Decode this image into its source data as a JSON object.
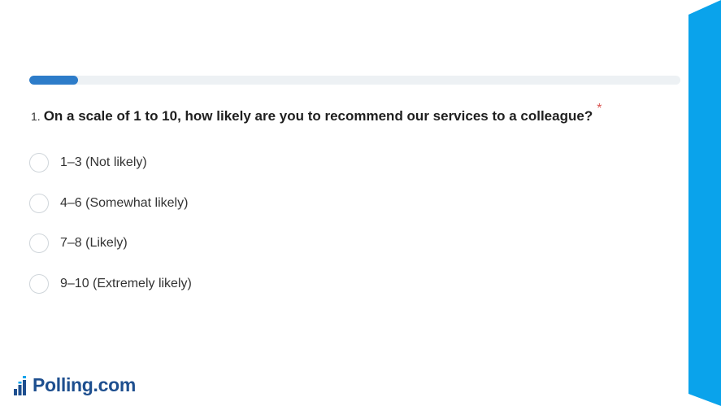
{
  "survey": {
    "progress": 0.075,
    "question": {
      "number": "1.",
      "text": "On a scale of 1 to 10, how likely are you to recommend our services to a colleague?",
      "required_marker": "*"
    },
    "options": [
      "1–3 (Not likely)",
      "4–6 (Somewhat likely)",
      "7–8 (Likely)",
      "9–10 (Extremely likely)"
    ]
  },
  "brand": {
    "name": "Polling.com",
    "icon": "bar-chart-stairs-icon"
  },
  "colors": {
    "progress_fill": "#2d7cc9",
    "progress_track": "#edf1f4",
    "side_accent": "#0aa3eb",
    "required": "#d9534f",
    "brand_text": "#1e4f8f"
  }
}
